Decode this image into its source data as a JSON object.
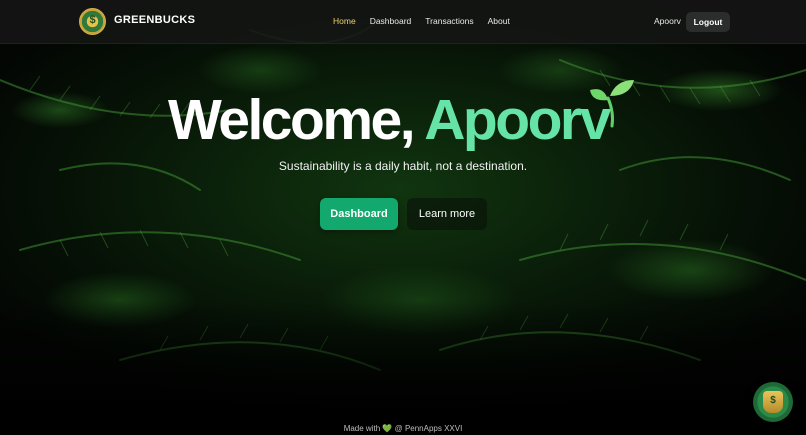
{
  "nav": {
    "brand": "GREENBUCKS",
    "links": [
      {
        "label": "Home",
        "active": true
      },
      {
        "label": "Dashboard",
        "active": false
      },
      {
        "label": "Transactions",
        "active": false
      },
      {
        "label": "About",
        "active": false
      }
    ],
    "user_name": "Apoorv",
    "logout_label": "Logout"
  },
  "hero": {
    "welcome": "Welcome, ",
    "user_name": "Apoorv",
    "tagline": "Sustainability is a daily habit, not a destination.",
    "primary_cta": "Dashboard",
    "secondary_cta": "Learn more"
  },
  "footer": {
    "prefix": "Made with",
    "heart": "💚",
    "suffix": "@ PennApps XXVI"
  },
  "icons": {
    "logo": "greenbucks-emblem-icon",
    "sprout": "sprout-icon",
    "chat_badge": "emblem-badge-icon"
  },
  "colors": {
    "accent": "#66e3a6",
    "primary_button": "#13a86e",
    "active_nav": "#f1d06b",
    "navbar_bg": "#141614"
  }
}
